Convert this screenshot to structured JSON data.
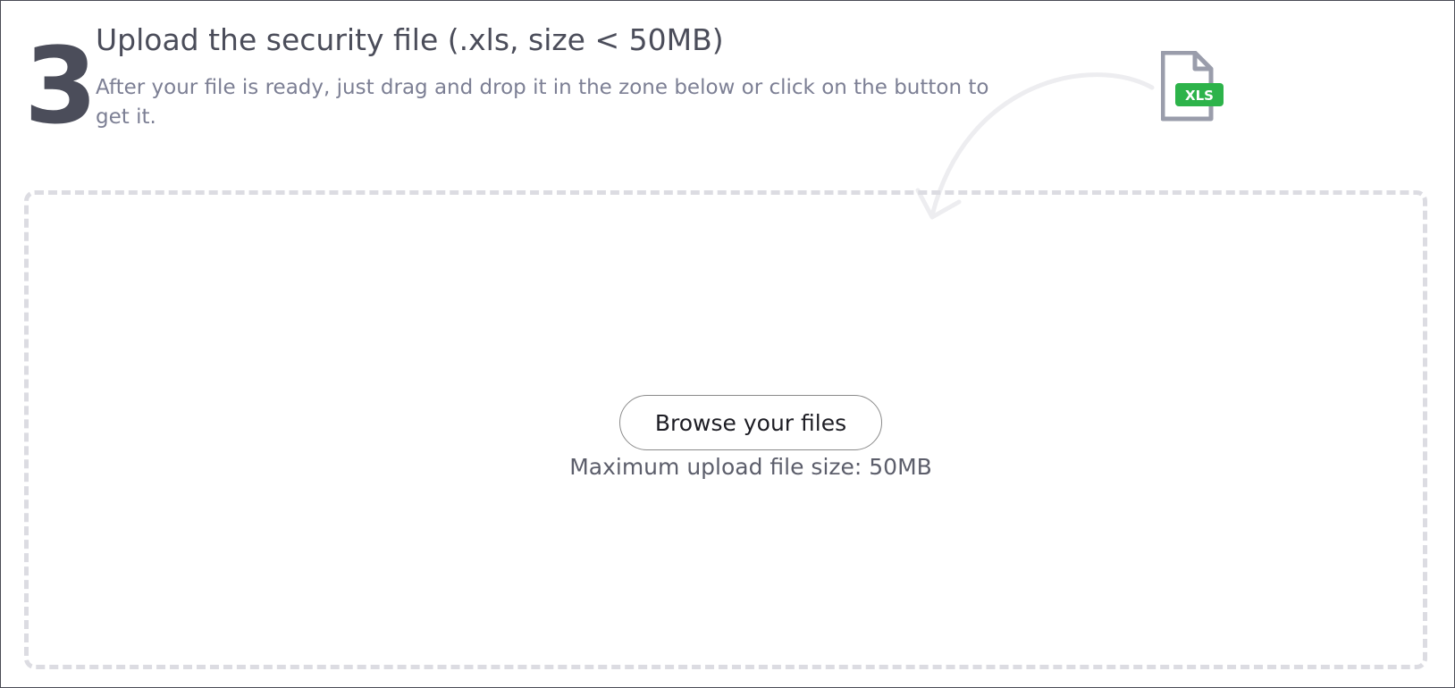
{
  "step": {
    "number": "3",
    "title": "Upload the security file (.xls, size < 50MB)",
    "description": "After your file is ready, just drag and drop it in the zone below or click on the button to get it."
  },
  "file_icon": {
    "name": "xls-file-icon",
    "badge_text": "XLS",
    "badge_color": "#2db34a",
    "page_color": "#9a9dab"
  },
  "dropzone": {
    "browse_label": "Browse your files",
    "max_size_text": "Maximum upload file size: 50MB",
    "border_color": "#dcdce2"
  }
}
